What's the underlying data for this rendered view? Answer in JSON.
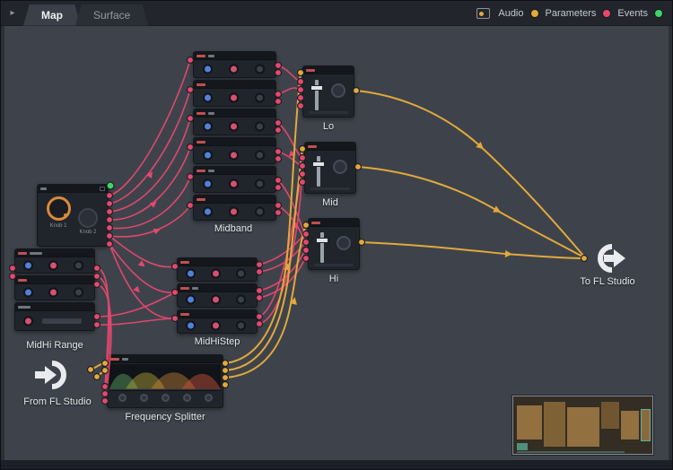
{
  "tabs": {
    "arrow": "▸",
    "items": [
      {
        "label": "Map",
        "active": true
      },
      {
        "label": "Surface",
        "active": false
      }
    ]
  },
  "legend": {
    "audio_label": "Audio",
    "parameters_label": "Parameters",
    "events_label": "Events",
    "audio_color": "#e2a93b",
    "parameters_color": "#e8486e",
    "events_color": "#3fd469"
  },
  "nodes": {
    "knob_module": {
      "knob1": "Knob 1",
      "knob2": "Knob 2"
    },
    "midhi_range_label": "MidHi Range",
    "from_fl_label": "From FL Studio",
    "freq_splitter_label": "Frequency Splitter",
    "midband_label": "Midband",
    "midhistep_label": "MidHiStep",
    "lo_label": "Lo",
    "mid_label": "Mid",
    "hi_label": "Hi",
    "to_fl_label": "To FL Studio"
  },
  "colors": {
    "canvas_bg": "#3e434b",
    "audio_wire": "#e2a93b",
    "parameter_wire": "#e8486e",
    "event_dot": "#3fd469"
  }
}
